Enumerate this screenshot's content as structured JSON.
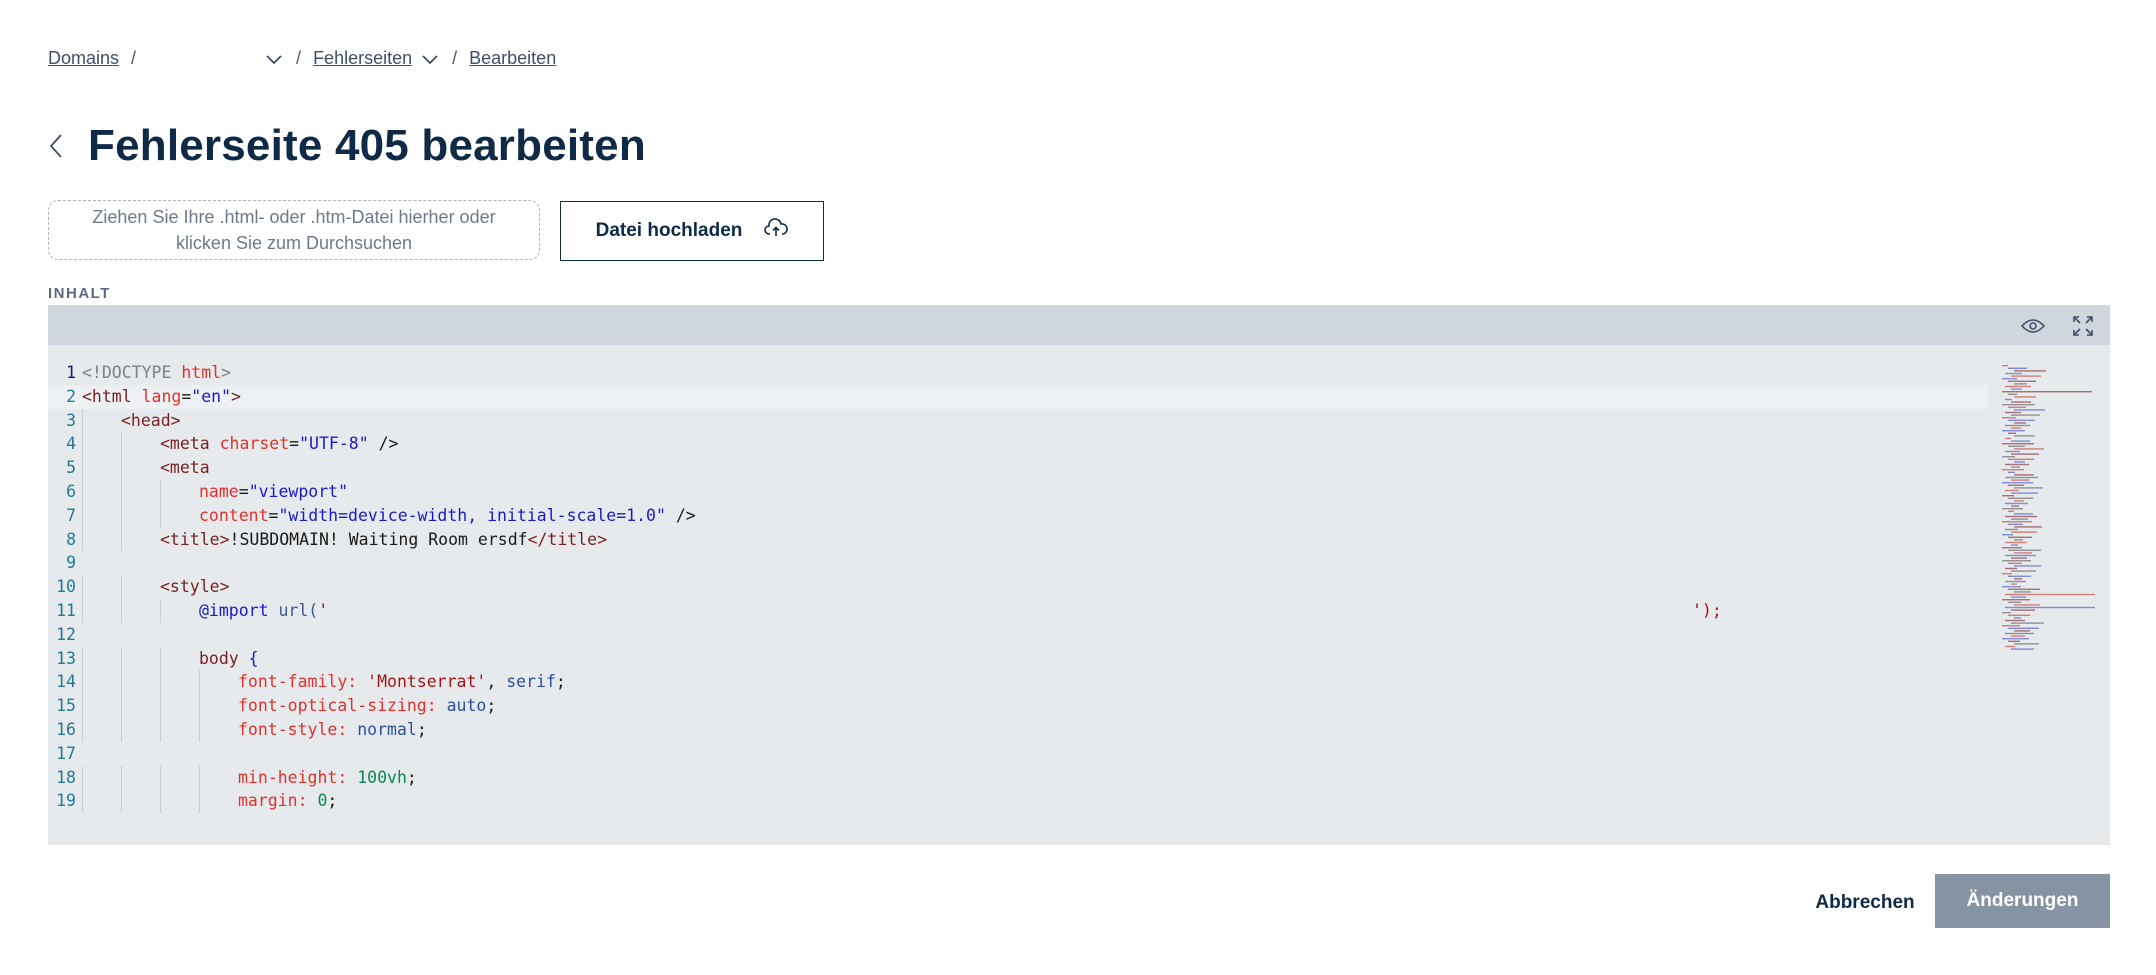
{
  "breadcrumb": {
    "items": [
      {
        "label": "Domains"
      },
      {
        "label": "Fehlerseiten"
      },
      {
        "label": "Bearbeiten"
      }
    ],
    "separator": "/"
  },
  "page": {
    "title": "Fehlerseite 405 bearbeiten"
  },
  "upload": {
    "dropzone_line1": "Ziehen Sie Ihre .html- oder .htm-Datei hierher oder",
    "dropzone_line2": "klicken Sie zum Durchsuchen",
    "button_label": "Datei hochladen"
  },
  "editor": {
    "section_label": "INHALT",
    "line_numbers": [
      "1",
      "2",
      "3",
      "4",
      "5",
      "6",
      "7",
      "8",
      "9",
      "10",
      "11",
      "12",
      "13",
      "14",
      "15",
      "16",
      "17",
      "18",
      "19"
    ],
    "lines": [
      {
        "parts": [
          [
            "gr",
            "<!DOCTYPE "
          ],
          [
            "at",
            "html"
          ],
          [
            "gr",
            ">"
          ]
        ]
      },
      {
        "parts": [
          [
            "tg",
            "<html "
          ],
          [
            "at",
            "lang"
          ],
          [
            "",
            "="
          ],
          [
            "st",
            "\"en\""
          ],
          [
            "tg",
            ">"
          ]
        ]
      },
      {
        "parts": [
          [
            "tg",
            "<head>"
          ]
        ]
      },
      {
        "parts": [
          [
            "tg",
            "<meta "
          ],
          [
            "at",
            "charset"
          ],
          [
            "",
            "="
          ],
          [
            "st",
            "\"UTF-8\""
          ],
          [
            "",
            " />"
          ]
        ]
      },
      {
        "parts": [
          [
            "tg",
            "<meta"
          ]
        ]
      },
      {
        "parts": [
          [
            "at",
            "name"
          ],
          [
            "",
            "="
          ],
          [
            "st",
            "\"viewport\""
          ]
        ]
      },
      {
        "parts": [
          [
            "at",
            "content"
          ],
          [
            "",
            "="
          ],
          [
            "st",
            "\"width=device-width, initial-scale=1.0\""
          ],
          [
            "",
            " />"
          ]
        ]
      },
      {
        "parts": [
          [
            "tg",
            "<title>"
          ],
          [
            "",
            "!SUBDOMAIN! Waiting Room ersdf"
          ],
          [
            "tg",
            "</title>"
          ]
        ]
      },
      {
        "parts": []
      },
      {
        "parts": [
          [
            "tg",
            "<style>"
          ]
        ]
      },
      {
        "parts": [
          [
            "kw",
            "@import "
          ],
          [
            "fn",
            "url("
          ],
          [
            "sr",
            "'"
          ]
        ],
        "tail": "');"
      },
      {
        "parts": []
      },
      {
        "parts": [
          [
            "tg",
            "body "
          ],
          [
            "kw",
            "{"
          ]
        ]
      },
      {
        "parts": [
          [
            "pr",
            "font-family: "
          ],
          [
            "sr",
            "'Montserrat'"
          ],
          [
            "",
            ", "
          ],
          [
            "vl",
            "serif"
          ],
          [
            "",
            ";"
          ]
        ]
      },
      {
        "parts": [
          [
            "pr",
            "font-optical-sizing: "
          ],
          [
            "vl",
            "auto"
          ],
          [
            "",
            ";"
          ]
        ]
      },
      {
        "parts": [
          [
            "pr",
            "font-style: "
          ],
          [
            "vl",
            "normal"
          ],
          [
            "",
            ";"
          ]
        ]
      },
      {
        "parts": []
      },
      {
        "parts": [
          [
            "pr",
            "min-height: "
          ],
          [
            "nm",
            "100vh"
          ],
          [
            "",
            ";"
          ]
        ]
      },
      {
        "parts": [
          [
            "pr",
            "margin: "
          ],
          [
            "nm",
            "0"
          ],
          [
            "",
            ";"
          ]
        ]
      }
    ],
    "indents": [
      0,
      0,
      1,
      2,
      2,
      3,
      3,
      2,
      0,
      2,
      3,
      0,
      3,
      4,
      4,
      4,
      0,
      4,
      4
    ]
  },
  "footer": {
    "cancel_label": "Abbrechen",
    "save_label": "Änderungen"
  }
}
